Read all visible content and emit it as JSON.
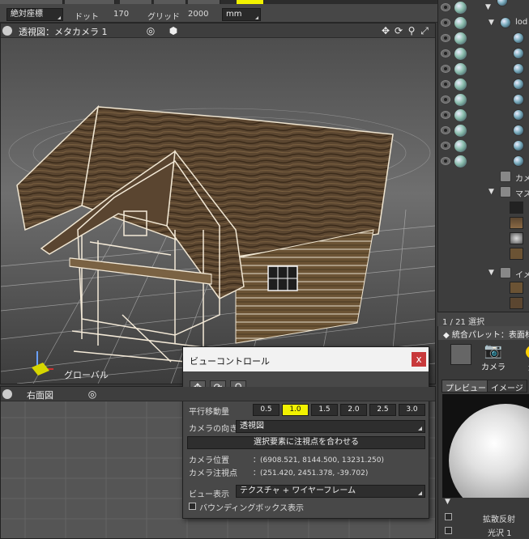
{
  "toolbar": {
    "coord_system": "絶対座標",
    "dot_label": "ドット",
    "dot_value": "170",
    "grid_label": "グリッド",
    "grid_value": "2000",
    "unit": "mm"
  },
  "perspective_view": {
    "title": "透視図：メタカメラ 1",
    "axis_label": "グローバル"
  },
  "side_view": {
    "title": "右面図"
  },
  "object_tree": {
    "rows": [
      {
        "label": ""
      },
      {
        "label": "lod"
      },
      {
        "label": ""
      },
      {
        "label": ""
      },
      {
        "label": ""
      },
      {
        "label": ""
      },
      {
        "label": ""
      },
      {
        "label": ""
      },
      {
        "label": ""
      },
      {
        "label": ""
      },
      {
        "label": ""
      },
      {
        "label": "カメ"
      },
      {
        "label": "マス"
      },
      {
        "label": "イメ"
      }
    ]
  },
  "status": {
    "selection": "1 / 21 選択"
  },
  "palette": {
    "title": "◆ 統合パレット：表面材",
    "camera_label": "カメラ",
    "light_label": "光",
    "tab_preview": "プレビュー",
    "tab_image": "イメージ",
    "diffuse_label": "拡散反射",
    "gloss_label": "光沢 1"
  },
  "dialog": {
    "title": "ビューコントロール",
    "close": "x",
    "pan_label": "平行移動量",
    "steps": [
      "0.5",
      "1.0",
      "1.5",
      "2.0",
      "2.5",
      "3.0"
    ],
    "active_step": "1.0",
    "camera_dir_label": "カメラの向き",
    "camera_dir_value": "透視図",
    "focus_button": "選択要素に注視点を合わせる",
    "camera_pos_label": "カメラ位置",
    "camera_pos_value": "：(6908.521, 8144.500, 13231.250)",
    "camera_target_label": "カメラ注視点",
    "camera_target_value": "：(251.420, 2451.378, -39.702)",
    "view_display_label": "ビュー表示",
    "view_display_value": "テクスチャ + ワイヤーフレーム",
    "bbox_label": "バウンディングボックス表示"
  },
  "colors": {
    "active_step": "#f2f200",
    "close_button": "#c8393b"
  }
}
